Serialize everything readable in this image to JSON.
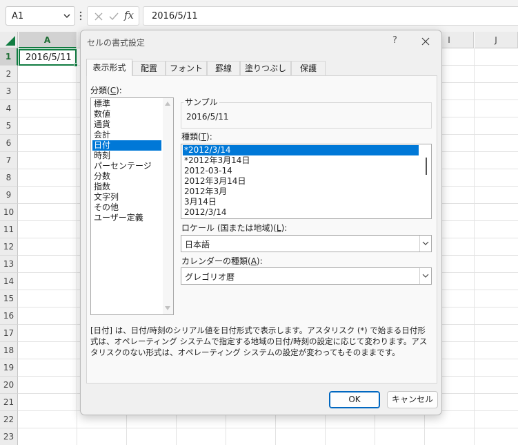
{
  "formula_bar": {
    "name_box": "A1",
    "fx_label": "fx",
    "formula": "2016/5/11"
  },
  "grid": {
    "columns": [
      "A",
      "",
      "",
      "",
      "",
      "",
      "",
      "",
      "I",
      "J"
    ],
    "rows": [
      "1",
      "2",
      "3",
      "4",
      "5",
      "6",
      "7",
      "8",
      "9",
      "10",
      "11",
      "12",
      "13",
      "14",
      "15",
      "16",
      "17",
      "18",
      "19",
      "20",
      "21",
      "22",
      "23"
    ],
    "cell_a1": "2016/5/11"
  },
  "dialog": {
    "title": "セルの書式設定",
    "help": "?",
    "tabs": [
      "表示形式",
      "配置",
      "フォント",
      "罫線",
      "塗りつぶし",
      "保護"
    ],
    "category_label": "分類(",
    "category_key": "C",
    "category_label_end": "):",
    "categories": [
      "標準",
      "数値",
      "通貨",
      "会計",
      "日付",
      "時刻",
      "パーセンテージ",
      "分数",
      "指数",
      "文字列",
      "その他",
      "ユーザー定義"
    ],
    "selected_category": "日付",
    "sample_label": "サンプル",
    "sample_value": "2016/5/11",
    "type_label": "種類(",
    "type_key": "T",
    "type_label_end": "):",
    "types": [
      "*2012/3/14",
      "*2012年3月14日",
      "2012-03-14",
      "2012年3月14日",
      "2012年3月",
      "3月14日",
      "2012/3/14"
    ],
    "selected_type": "*2012/3/14",
    "locale_label": "ロケール (国または地域)(",
    "locale_key": "L",
    "locale_label_end": "):",
    "locale_value": "日本語",
    "calendar_label": "カレンダーの種類(",
    "calendar_key": "A",
    "calendar_label_end": "):",
    "calendar_value": "グレゴリオ暦",
    "description": "[日付] は、日付/時刻のシリアル値を日付形式で表示します。アスタリスク (*) で始まる日付形式は、オペレーティング システムで指定する地域の日付/時刻の設定に応じて変わります。アスタリスクのない形式は、オペレーティング システムの設定が変わってもそのままです。",
    "ok_label": "OK",
    "cancel_label": "キャンセル"
  },
  "colors": {
    "selection_blue": "#0078d7",
    "excel_green": "#107c41"
  }
}
